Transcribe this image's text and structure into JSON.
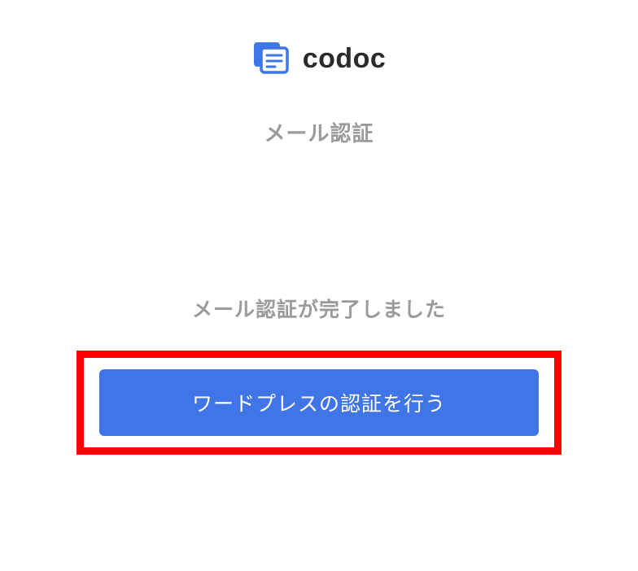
{
  "brand": {
    "name": "codoc"
  },
  "page": {
    "title": "メール認証",
    "message": "メール認証が完了しました"
  },
  "actions": {
    "wordpress_auth_label": "ワードプレスの認証を行う"
  }
}
